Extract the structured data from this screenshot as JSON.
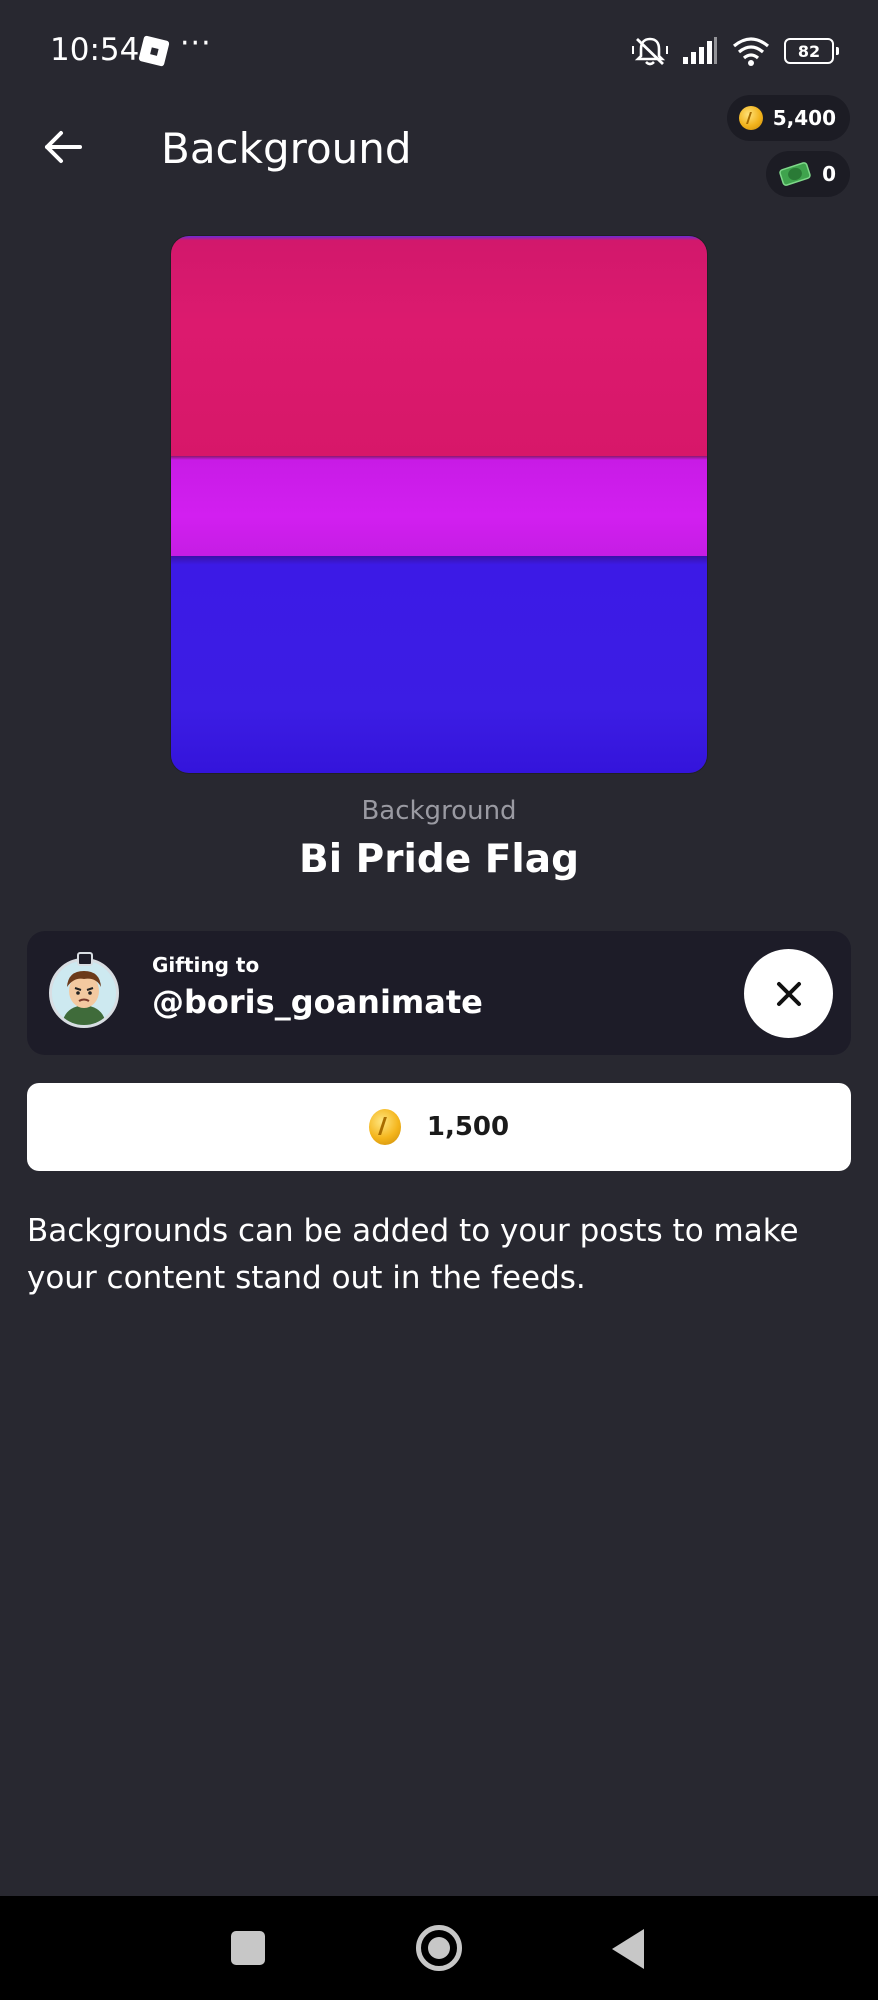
{
  "status_bar": {
    "time": "10:54",
    "more": "···",
    "battery": "82",
    "icons": [
      "roblox-icon",
      "more-icon",
      "mute-icon",
      "signal-icon",
      "wifi-icon",
      "battery-icon"
    ]
  },
  "header": {
    "title": "Background",
    "back_icon": "arrow-left-icon"
  },
  "wallet": {
    "coins": "5,400",
    "cash": "0"
  },
  "item": {
    "type": "Background",
    "name": "Bi Pride Flag",
    "colors": {
      "pink": "#dc1a6e",
      "purple": "#d21ff0",
      "blue": "#3c1de4"
    }
  },
  "gift": {
    "label": "Gifting to",
    "username": "@boris_goanimate",
    "close_icon": "close-icon"
  },
  "purchase": {
    "price": "1,500",
    "currency_icon": "coin-icon"
  },
  "description": "Backgrounds can be added to your posts to make your content stand out in the feeds.",
  "nav": {
    "icons": [
      "recents-icon",
      "home-icon",
      "back-icon"
    ]
  },
  "theme": {
    "background": "#282830",
    "card": "#1d1c28",
    "text": "#ffffff",
    "muted": "#9a9aa2"
  }
}
